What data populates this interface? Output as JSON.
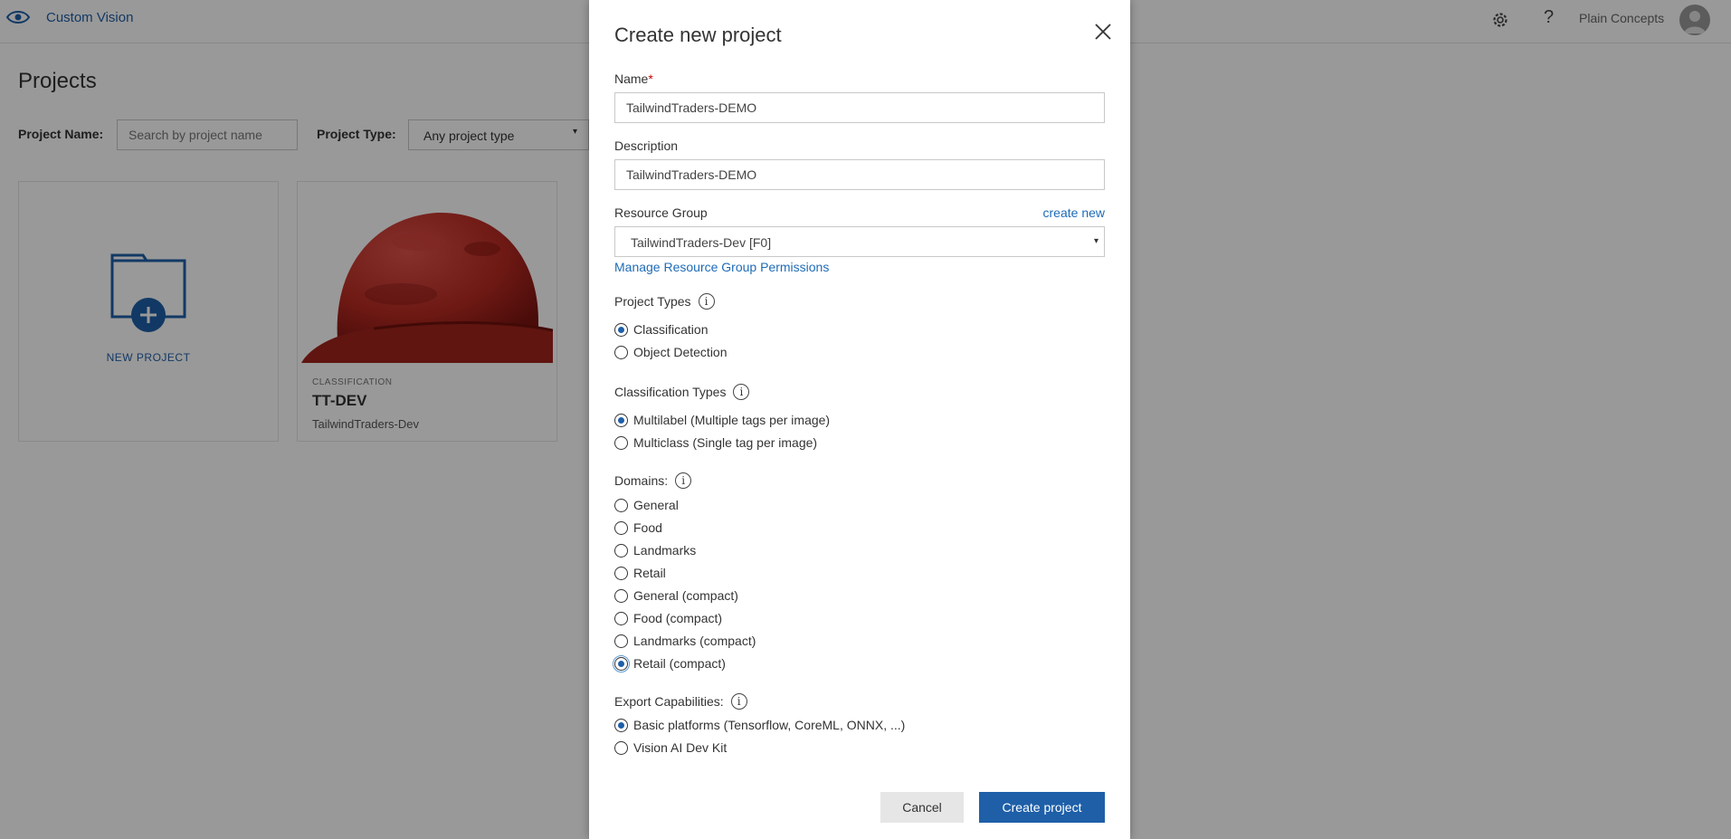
{
  "app": {
    "brand_icon": "eye-icon",
    "name": "Custom Vision",
    "user_name": "Plain Concepts"
  },
  "projects_page": {
    "title": "Projects",
    "filter_name_label": "Project Name:",
    "filter_name_placeholder": "Search by project name",
    "filter_type_label": "Project Type:",
    "filter_type_value": "Any project type",
    "new_project_label": "NEW PROJECT",
    "projects": [
      {
        "category": "CLASSIFICATION",
        "name": "TT-DEV",
        "resource": "TailwindTraders-Dev"
      }
    ]
  },
  "modal": {
    "title": "Create new project",
    "name_label": "Name",
    "required_mark": "*",
    "name_value": "TailwindTraders-DEMO",
    "description_label": "Description",
    "description_value": "TailwindTraders-DEMO",
    "resource_group_label": "Resource Group",
    "create_new_link": "create new",
    "resource_group_value": "TailwindTraders-Dev [F0]",
    "manage_link": "Manage Resource Group Permissions",
    "project_types_label": "Project Types",
    "project_types": [
      {
        "label": "Classification",
        "checked": true
      },
      {
        "label": "Object Detection",
        "checked": false
      }
    ],
    "classification_types_label": "Classification Types",
    "classification_types": [
      {
        "label": "Multilabel (Multiple tags per image)",
        "checked": true
      },
      {
        "label": "Multiclass (Single tag per image)",
        "checked": false
      }
    ],
    "domains_label": "Domains:",
    "domains": [
      {
        "label": "General",
        "checked": false
      },
      {
        "label": "Food",
        "checked": false
      },
      {
        "label": "Landmarks",
        "checked": false
      },
      {
        "label": "Retail",
        "checked": false
      },
      {
        "label": "General (compact)",
        "checked": false
      },
      {
        "label": "Food (compact)",
        "checked": false
      },
      {
        "label": "Landmarks (compact)",
        "checked": false
      },
      {
        "label": "Retail (compact)",
        "checked": true
      }
    ],
    "export_label": "Export Capabilities:",
    "export": [
      {
        "label": "Basic platforms (Tensorflow, CoreML, ONNX, ...)",
        "checked": true
      },
      {
        "label": "Vision AI Dev Kit",
        "checked": false
      }
    ],
    "info_glyph": "i",
    "cancel_label": "Cancel",
    "create_label": "Create project",
    "accent_color": "#1e5fa8",
    "dropdown_caret": "▾"
  }
}
